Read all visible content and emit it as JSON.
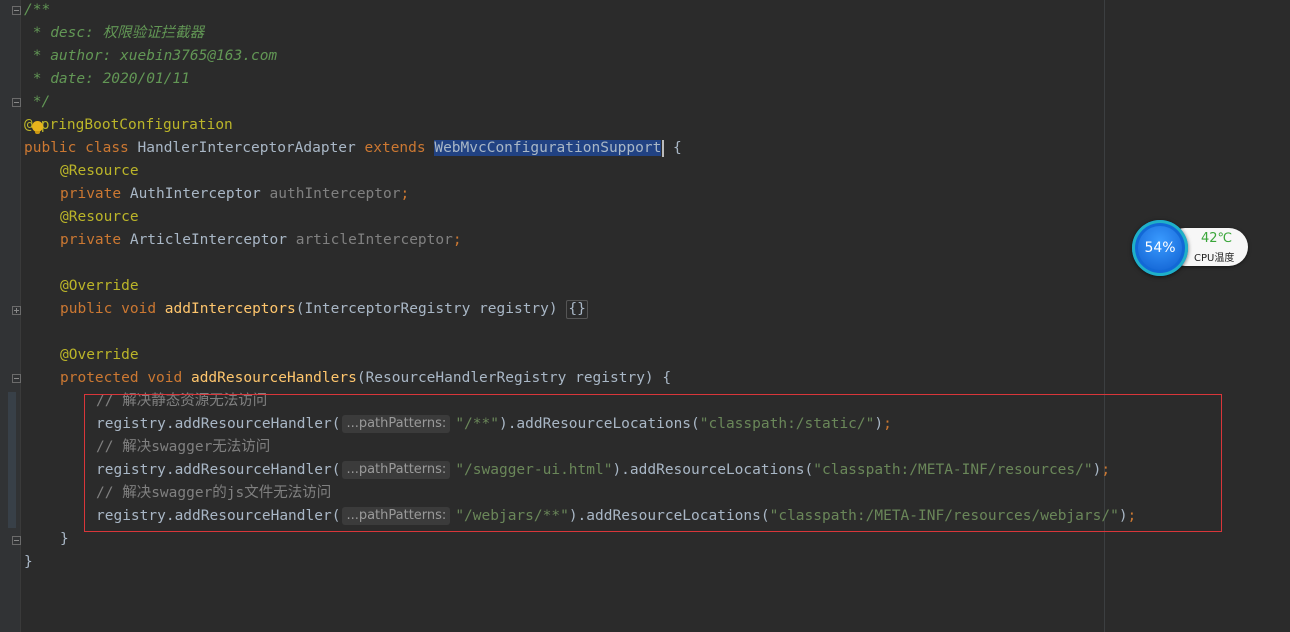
{
  "javadoc": {
    "open": "/**",
    "desc": " * desc: 权限验证拦截器",
    "author": " * author: xuebin3765@163.com",
    "date": " * date: 2020/01/11",
    "close": " */"
  },
  "annotations": {
    "at": "@",
    "spring_boot_configuration_rest": "pringBootConfiguration",
    "resource": "@Resource",
    "override": "@Override"
  },
  "class_decl": {
    "public": "public",
    "class": "class",
    "name": "HandlerInterceptorAdapter",
    "extends": "extends",
    "super": "WebMvcConfigurationSupport",
    "brace": " {"
  },
  "fields": [
    {
      "modifier": "private",
      "type": "AuthInterceptor",
      "name": "authInterceptor"
    },
    {
      "modifier": "private",
      "type": "ArticleInterceptor",
      "name": "articleInterceptor"
    }
  ],
  "method1": {
    "public": "public",
    "void": "void",
    "name": "addInterceptors",
    "params": "(InterceptorRegistry registry) ",
    "body": "{}"
  },
  "method2": {
    "protected": "protected",
    "void": "void",
    "name": "addResourceHandlers",
    "params": "(ResourceHandlerRegistry registry) {"
  },
  "body_lines": [
    {
      "comment": "// 解决静态资源无法访问"
    },
    {
      "call": "registry.addResourceHandler(",
      "hint": "...pathPatterns:",
      "arg": "\"/**\"",
      "mid": ").addResourceLocations(",
      "loc": "\"classpath:/static/\"",
      "end": ")",
      "semi": ";"
    },
    {
      "comment": "// 解决swagger无法访问"
    },
    {
      "call": "registry.addResourceHandler(",
      "hint": "...pathPatterns:",
      "arg": "\"/swagger-ui.html\"",
      "mid": ").addResourceLocations(",
      "loc": "\"classpath:/META-INF/resources/\"",
      "end": ")",
      "semi": ";"
    },
    {
      "comment": "// 解决swagger的js文件无法访问"
    },
    {
      "call": "registry.addResourceHandler(",
      "hint": "...pathPatterns:",
      "arg": "\"/webjars/**\"",
      "mid": ").addResourceLocations(",
      "loc": "\"classpath:/META-INF/resources/webjars/\"",
      "end": ")",
      "semi": ";"
    }
  ],
  "closing": {
    "method": "}",
    "class": "}"
  },
  "semicolon": ";",
  "cpu_widget": {
    "percent": "54%",
    "temp": "42℃",
    "label": "CPU温度"
  }
}
